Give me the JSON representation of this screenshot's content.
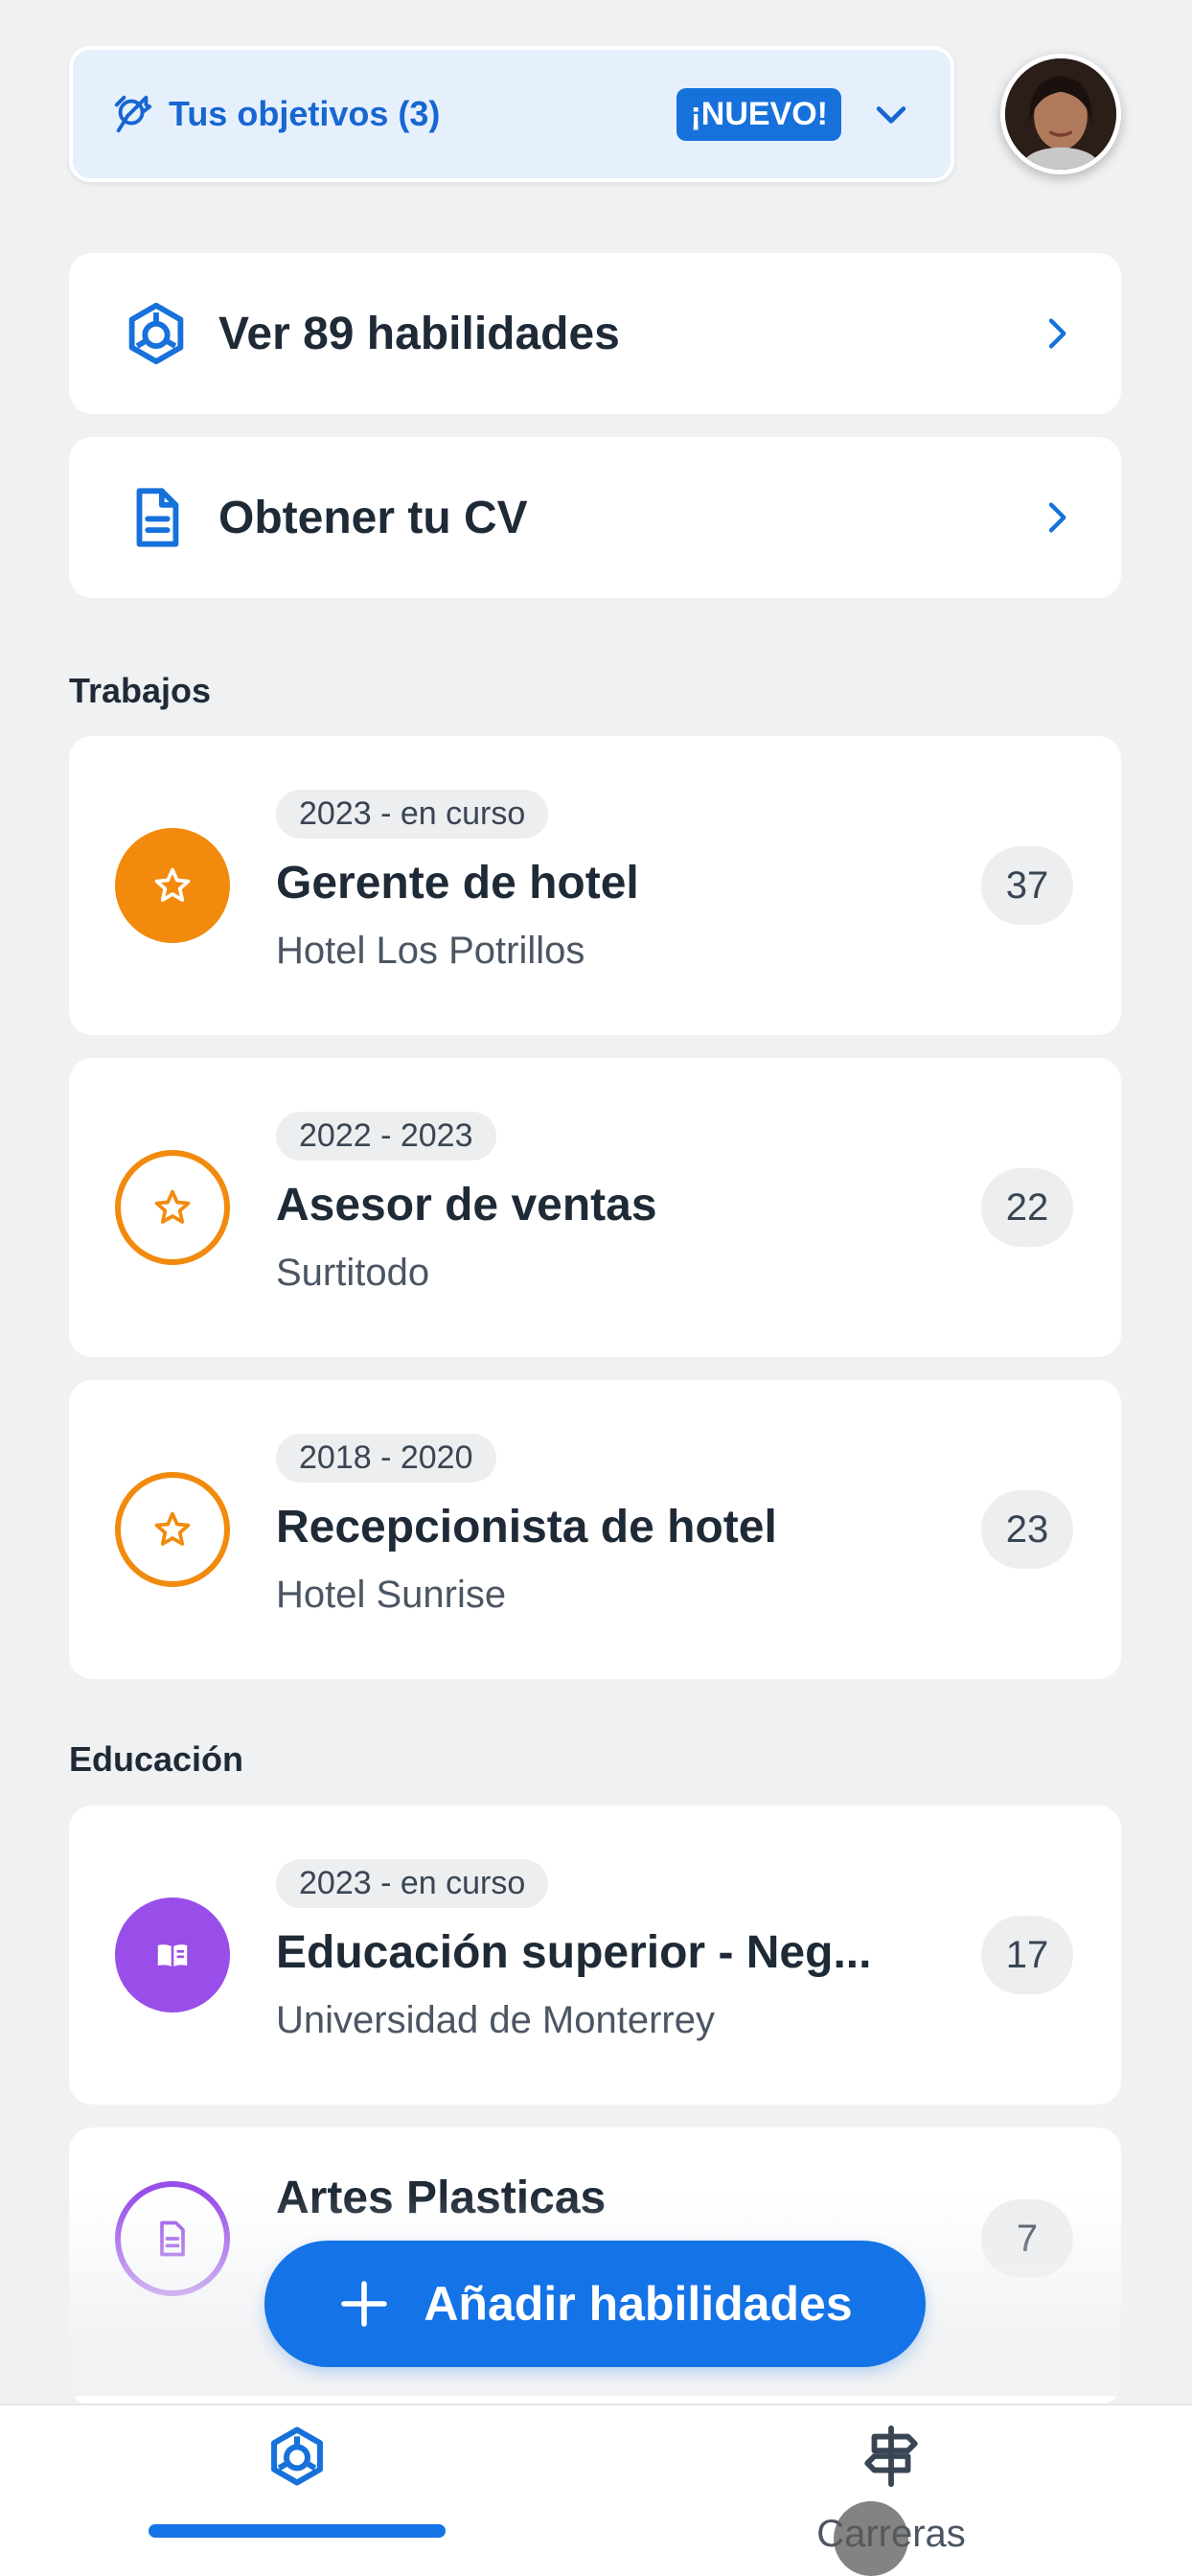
{
  "goals": {
    "label": "Tus objetivos (3)",
    "badge": "¡NUEVO!"
  },
  "links": [
    {
      "label": "Ver 89 habilidades",
      "icon": "skills-hex-icon"
    },
    {
      "label": "Obtener tu CV",
      "icon": "document-icon"
    }
  ],
  "sections": {
    "jobs": "Trabajos",
    "education": "Educación"
  },
  "jobs": [
    {
      "date": "2023 - en curso",
      "title": "Gerente de hotel",
      "org": "Hotel Los Potrillos",
      "count": "37",
      "style": "filled"
    },
    {
      "date": "2022 - 2023",
      "title": "Asesor de ventas",
      "org": "Surtitodo",
      "count": "22",
      "style": "outline"
    },
    {
      "date": "2018 - 2020",
      "title": "Recepcionista de hotel",
      "org": "Hotel Sunrise",
      "count": "23",
      "style": "outline"
    }
  ],
  "education": [
    {
      "date": "2023 - en curso",
      "title": "Educación superior - Neg...",
      "org": "Universidad de Monterrey",
      "count": "17",
      "style": "filled"
    },
    {
      "title": "Artes Plasticas",
      "count": "7",
      "style": "outline"
    }
  ],
  "fab": {
    "label": "Añadir habilidades"
  },
  "nav": {
    "careers_label": "Carreras"
  },
  "colors": {
    "accent": "#1473e6",
    "job": "#f28a0d",
    "education": "#9a4ee9",
    "background": "#eff1f3"
  }
}
